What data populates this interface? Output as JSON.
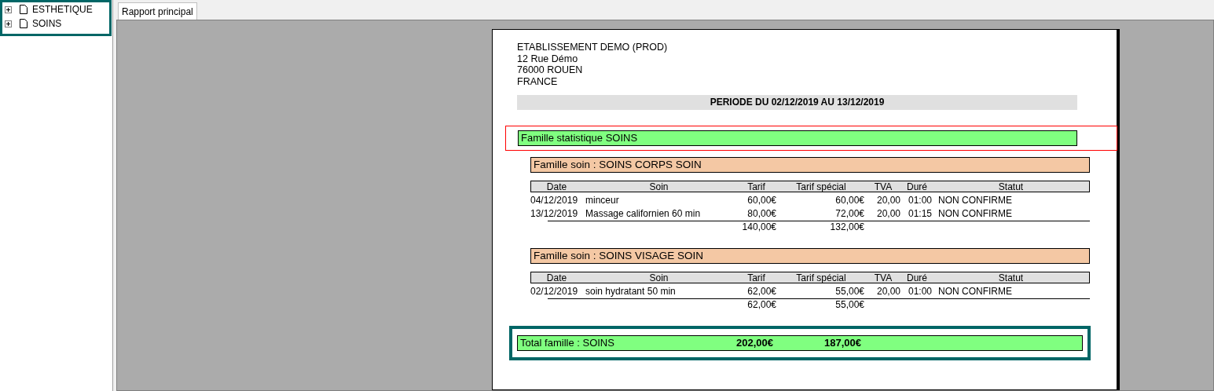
{
  "tree": {
    "items": [
      {
        "label": "ESTHETIQUE",
        "expanded": false
      },
      {
        "label": "SOINS",
        "expanded": false
      }
    ]
  },
  "tabs": [
    {
      "label": "Rapport principal",
      "selected": true
    }
  ],
  "report": {
    "address": [
      "ETABLISSEMENT DEMO (PROD)",
      "12 Rue Démo",
      "76000 ROUEN",
      "FRANCE"
    ],
    "period": "PERIODE DU 02/12/2019 AU 13/12/2019",
    "family": "Famille statistique  SOINS",
    "groups": [
      {
        "title": "Famille soin : SOINS CORPS SOIN",
        "columns": [
          "Date",
          "Soin",
          "Tarif",
          "Tarif spécial",
          "TVA",
          "Duré",
          "Statut"
        ],
        "rows": [
          [
            "04/12/2019",
            "minceur",
            "60,00€",
            "60,00€",
            "20,00",
            "01:00",
            "NON CONFIRME"
          ],
          [
            "13/12/2019",
            "Massage californien 60 min",
            "80,00€",
            "72,00€",
            "20,00",
            "01:15",
            "NON CONFIRME"
          ]
        ],
        "totals": [
          "140,00€",
          "132,00€"
        ]
      },
      {
        "title": "Famille soin : SOINS VISAGE SOIN",
        "columns": [
          "Date",
          "Soin",
          "Tarif",
          "Tarif spécial",
          "TVA",
          "Duré",
          "Statut"
        ],
        "rows": [
          [
            "02/12/2019",
            "soin hydratant 50 min",
            "62,00€",
            "55,00€",
            "20,00",
            "01:00",
            "NON CONFIRME"
          ]
        ],
        "totals": [
          "62,00€",
          "55,00€"
        ]
      }
    ],
    "total": {
      "label": "Total famille : SOINS",
      "values": [
        "202,00€",
        "187,00€"
      ]
    }
  }
}
